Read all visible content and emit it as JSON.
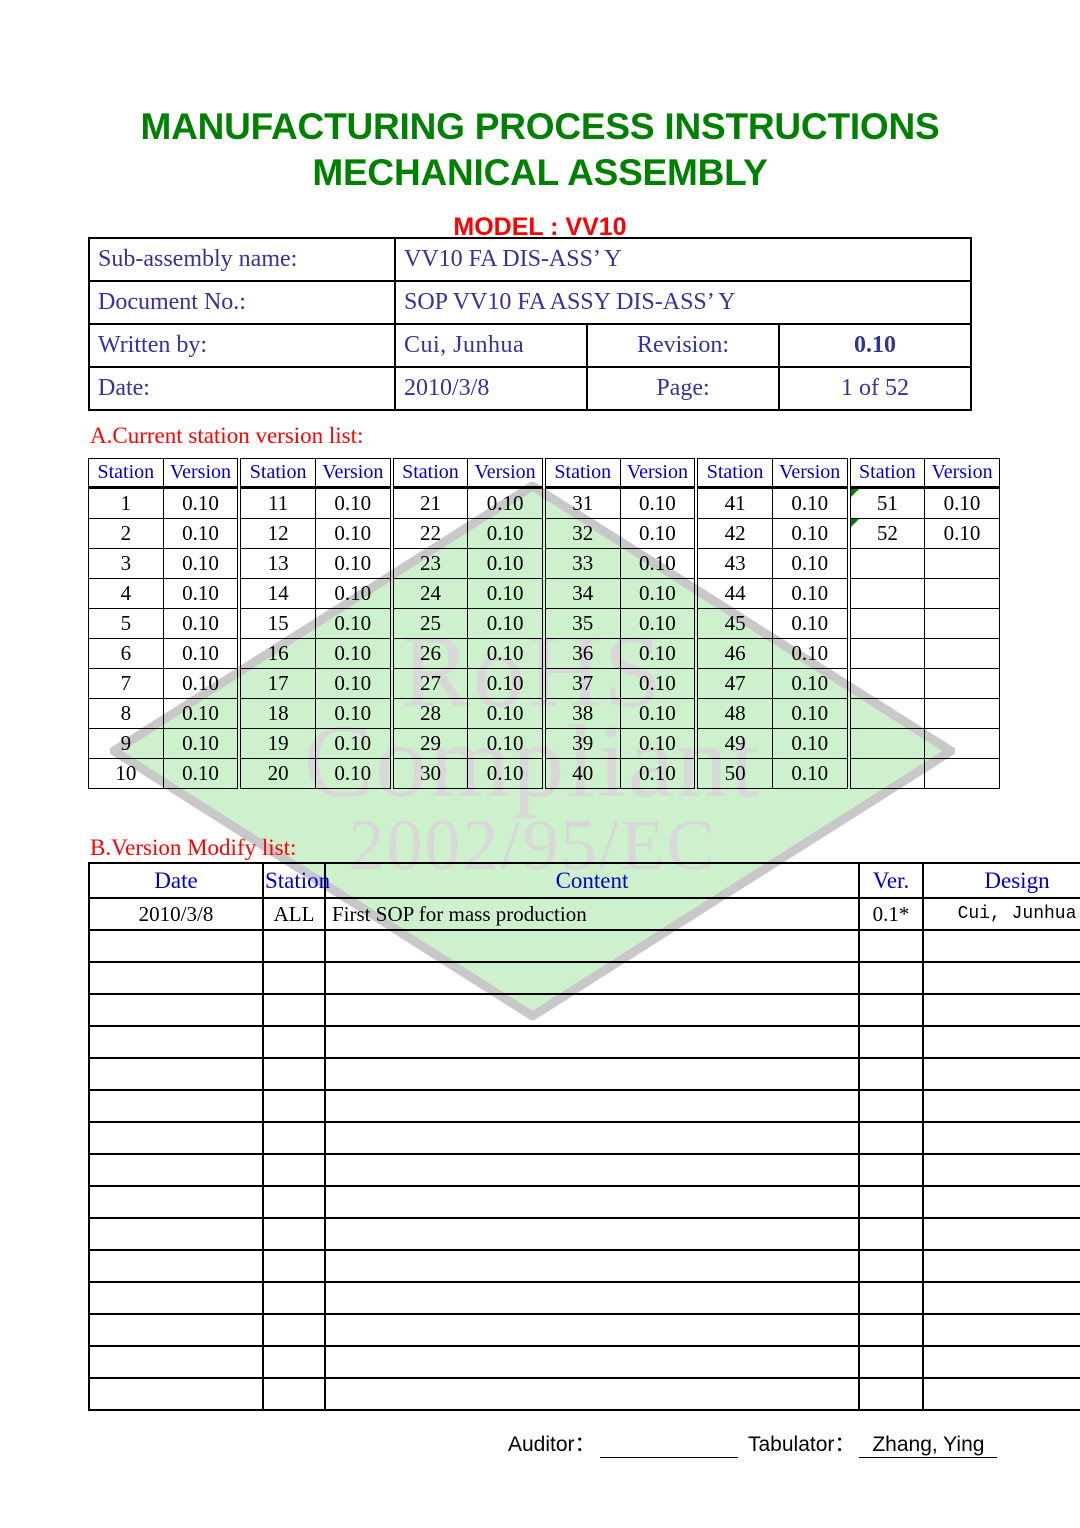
{
  "document": {
    "title_line1": "MANUFACTURING PROCESS INSTRUCTIONS",
    "title_line2": "MECHANICAL ASSEMBLY",
    "model_title": "MODEL : VV10",
    "title_color": "#008000",
    "model_color": "#ff0000"
  },
  "info": {
    "subassembly_label": "Sub-assembly name:",
    "subassembly_value": "VV10 FA DIS-ASS’ Y",
    "document_no_label": "Document No.:",
    "document_no_value": "SOP VV10 FA ASSY DIS-ASS’ Y",
    "written_by_label": "Written by:",
    "written_by_value": "Cui, Junhua",
    "revision_label": "Revision:",
    "revision_value": "0.10",
    "date_label": "Date:",
    "date_value": "2010/3/8",
    "page_label": "Page:",
    "page_value": "1 of 52"
  },
  "section_a": {
    "heading": "A.Current station version list:",
    "col_station": "Station",
    "col_version": "Version",
    "pairs": 6,
    "rows": [
      [
        {
          "station": "1",
          "version": "0.10"
        },
        {
          "station": "11",
          "version": "0.10"
        },
        {
          "station": "21",
          "version": "0.10"
        },
        {
          "station": "31",
          "version": "0.10"
        },
        {
          "station": "41",
          "version": "0.10"
        },
        {
          "station": "51",
          "version": "0.10",
          "comment": true
        }
      ],
      [
        {
          "station": "2",
          "version": "0.10"
        },
        {
          "station": "12",
          "version": "0.10"
        },
        {
          "station": "22",
          "version": "0.10"
        },
        {
          "station": "32",
          "version": "0.10"
        },
        {
          "station": "42",
          "version": "0.10"
        },
        {
          "station": "52",
          "version": "0.10",
          "comment": true
        }
      ],
      [
        {
          "station": "3",
          "version": "0.10"
        },
        {
          "station": "13",
          "version": "0.10"
        },
        {
          "station": "23",
          "version": "0.10"
        },
        {
          "station": "33",
          "version": "0.10"
        },
        {
          "station": "43",
          "version": "0.10"
        },
        {
          "station": "",
          "version": ""
        }
      ],
      [
        {
          "station": "4",
          "version": "0.10"
        },
        {
          "station": "14",
          "version": "0.10"
        },
        {
          "station": "24",
          "version": "0.10"
        },
        {
          "station": "34",
          "version": "0.10"
        },
        {
          "station": "44",
          "version": "0.10"
        },
        {
          "station": "",
          "version": ""
        }
      ],
      [
        {
          "station": "5",
          "version": "0.10"
        },
        {
          "station": "15",
          "version": "0.10"
        },
        {
          "station": "25",
          "version": "0.10"
        },
        {
          "station": "35",
          "version": "0.10"
        },
        {
          "station": "45",
          "version": "0.10"
        },
        {
          "station": "",
          "version": ""
        }
      ],
      [
        {
          "station": "6",
          "version": "0.10"
        },
        {
          "station": "16",
          "version": "0.10"
        },
        {
          "station": "26",
          "version": "0.10"
        },
        {
          "station": "36",
          "version": "0.10"
        },
        {
          "station": "46",
          "version": "0.10"
        },
        {
          "station": "",
          "version": ""
        }
      ],
      [
        {
          "station": "7",
          "version": "0.10"
        },
        {
          "station": "17",
          "version": "0.10"
        },
        {
          "station": "27",
          "version": "0.10"
        },
        {
          "station": "37",
          "version": "0.10"
        },
        {
          "station": "47",
          "version": "0.10"
        },
        {
          "station": "",
          "version": ""
        }
      ],
      [
        {
          "station": "8",
          "version": "0.10"
        },
        {
          "station": "18",
          "version": "0.10"
        },
        {
          "station": "28",
          "version": "0.10"
        },
        {
          "station": "38",
          "version": "0.10"
        },
        {
          "station": "48",
          "version": "0.10"
        },
        {
          "station": "",
          "version": ""
        }
      ],
      [
        {
          "station": "9",
          "version": "0.10"
        },
        {
          "station": "19",
          "version": "0.10"
        },
        {
          "station": "29",
          "version": "0.10"
        },
        {
          "station": "39",
          "version": "0.10"
        },
        {
          "station": "49",
          "version": "0.10"
        },
        {
          "station": "",
          "version": ""
        }
      ],
      [
        {
          "station": "10",
          "version": "0.10"
        },
        {
          "station": "20",
          "version": "0.10"
        },
        {
          "station": "30",
          "version": "0.10"
        },
        {
          "station": "40",
          "version": "0.10"
        },
        {
          "station": "50",
          "version": "0.10"
        },
        {
          "station": "",
          "version": ""
        }
      ]
    ]
  },
  "section_b": {
    "heading": "B.Version Modify  list:",
    "headers": [
      "Date",
      "Station",
      "Content",
      "Ver.",
      "Design"
    ],
    "rows": [
      {
        "date": "2010/3/8",
        "station": "ALL",
        "content": "First SOP for mass production",
        "ver": "0.1*",
        "design": "Cui, Junhua"
      }
    ],
    "empty_rows": 15
  },
  "watermark": {
    "line1": "RoHS",
    "line2": "Compliant",
    "line3": "2002/95/EC",
    "fill_color": "#cdf0cd",
    "stroke_color": "#c8c8c8",
    "text_color": "#d8d8d8"
  },
  "footer": {
    "auditor_label": "Auditor：",
    "auditor_value": "",
    "tabulator_label": "Tabulator：",
    "tabulator_value": "Zhang, Ying"
  }
}
